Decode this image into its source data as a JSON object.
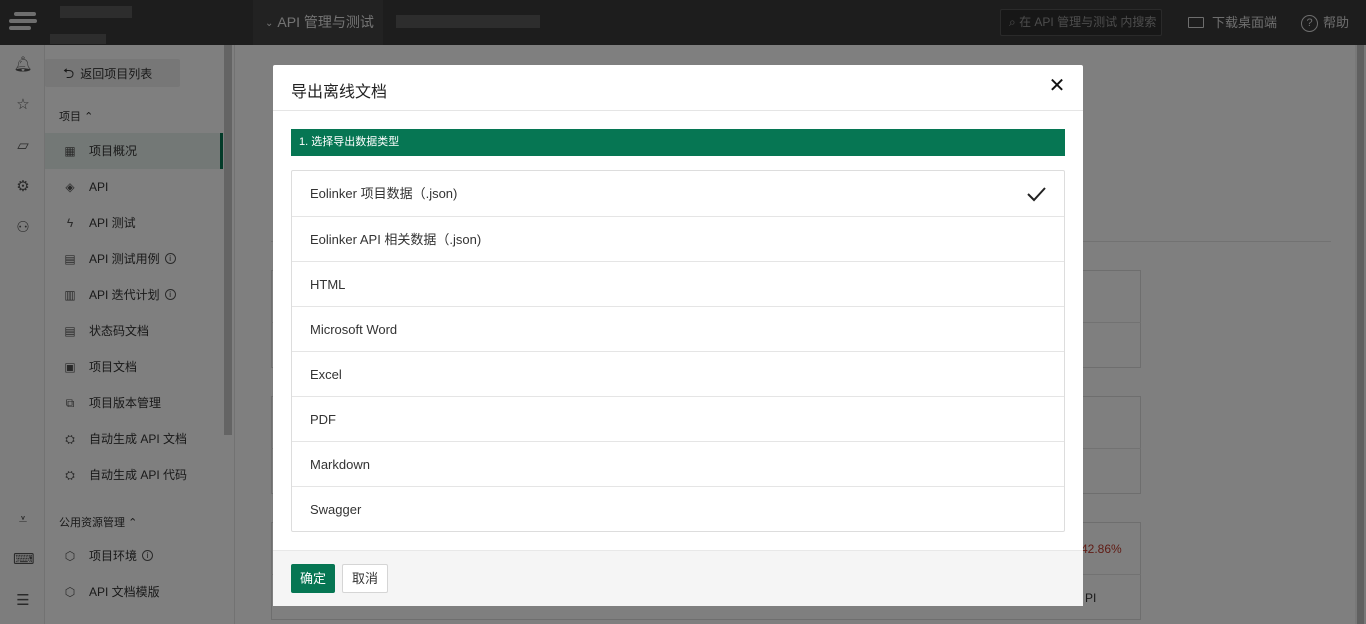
{
  "header": {
    "project_tab": "API 管理与测试",
    "search_placeholder": "在 API 管理与测试 内搜索",
    "download_label": "下载桌面端",
    "help_label": "帮助"
  },
  "sidebar": {
    "back_label": "返回项目列表",
    "section_project": "项目",
    "section_public": "公用资源管理",
    "items": [
      {
        "label": "项目概况"
      },
      {
        "label": "API"
      },
      {
        "label": "API 测试"
      },
      {
        "label": "API 测试用例"
      },
      {
        "label": "API 迭代计划"
      },
      {
        "label": "状态码文档"
      },
      {
        "label": "项目文档"
      },
      {
        "label": "项目版本管理"
      },
      {
        "label": "自动生成 API 文档"
      },
      {
        "label": "自动生成 API 代码"
      }
    ],
    "public_items": [
      {
        "label": "项目环境"
      },
      {
        "label": "API 文档模版"
      }
    ]
  },
  "background": {
    "percent": "42.86%",
    "api_text": "PI"
  },
  "modal": {
    "title": "导出离线文档",
    "close": "✕",
    "step_label": "1. 选择导出数据类型",
    "options": [
      {
        "label": "Eolinker 项目数据（.json)",
        "selected": true
      },
      {
        "label": "Eolinker API 相关数据（.json)",
        "selected": false
      },
      {
        "label": "HTML",
        "selected": false
      },
      {
        "label": "Microsoft Word",
        "selected": false
      },
      {
        "label": "Excel",
        "selected": false
      },
      {
        "label": "PDF",
        "selected": false
      },
      {
        "label": "Markdown",
        "selected": false
      },
      {
        "label": "Swagger",
        "selected": false
      }
    ],
    "confirm_label": "确定",
    "cancel_label": "取消"
  },
  "colors": {
    "accent": "#067653",
    "topbar": "#3a3a3a"
  }
}
